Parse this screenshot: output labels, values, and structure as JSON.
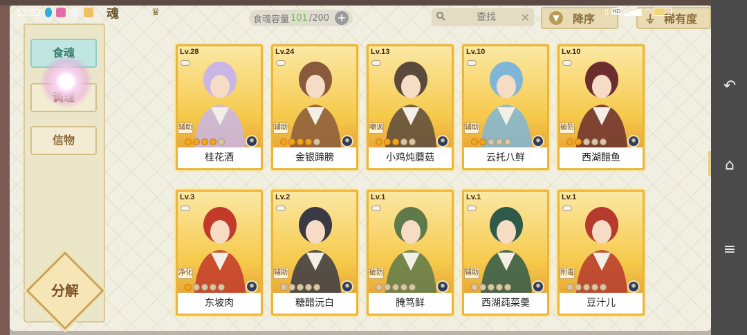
{
  "status_bar": {
    "time": "13:32"
  },
  "header": {
    "title": "魂",
    "capacity_label": "食魂容量",
    "capacity_current": "101",
    "capacity_max": "/200",
    "capacity_add": "+",
    "search_placeholder": "查找",
    "search_clear": "✕",
    "sort_order_label": "降序",
    "sort_field_label": "稀有度"
  },
  "sidebar": {
    "items": [
      {
        "label": "食魂",
        "active": true
      },
      {
        "label": "调理"
      },
      {
        "label": "信物"
      }
    ],
    "decompose_label": "分解"
  },
  "cards": [
    {
      "level": "Lv.28",
      "role": "辅助",
      "name": "桂花酒",
      "stars_filled": 4,
      "stars_total": 5,
      "art_color": "#c9b6e6"
    },
    {
      "level": "Lv.24",
      "role": "辅助",
      "name": "金银蹄膀",
      "stars_filled": 4,
      "stars_total": 5,
      "art_color": "#8a5a3c"
    },
    {
      "level": "Lv.13",
      "role": "嘲讽",
      "name": "小鸡炖蘑菇",
      "stars_filled": 3,
      "stars_total": 5,
      "art_color": "#5b4a3c"
    },
    {
      "level": "Lv.10",
      "role": "辅助",
      "name": "云托八鲜",
      "stars_filled": 2,
      "stars_total": 5,
      "art_color": "#7fb6d8"
    },
    {
      "level": "Lv.10",
      "role": "破防",
      "name": "西湖醋鱼",
      "stars_filled": 2,
      "stars_total": 5,
      "art_color": "#6a2e2e"
    },
    {
      "level": "Lv.3",
      "role": "净化",
      "name": "东坡肉",
      "stars_filled": 1,
      "stars_total": 5,
      "art_color": "#c23a2a"
    },
    {
      "level": "Lv.2",
      "role": "辅助",
      "name": "糖醋沅白",
      "stars_filled": 0,
      "stars_total": 5,
      "art_color": "#3a3a44"
    },
    {
      "level": "Lv.1",
      "role": "破防",
      "name": "腌笃鲜",
      "stars_filled": 0,
      "stars_total": 5,
      "art_color": "#5e7a4a"
    },
    {
      "level": "Lv.1",
      "role": "辅助",
      "name": "西湖莼菜羹",
      "stars_filled": 0,
      "stars_total": 5,
      "art_color": "#2f5a4a"
    },
    {
      "level": "Lv.1",
      "role": "附毒",
      "name": "豆汁儿",
      "stars_filled": 0,
      "stars_total": 5,
      "art_color": "#b63a2e"
    }
  ],
  "nav_bar": {
    "back": "↶",
    "home": "⌂",
    "menu": "≡"
  }
}
